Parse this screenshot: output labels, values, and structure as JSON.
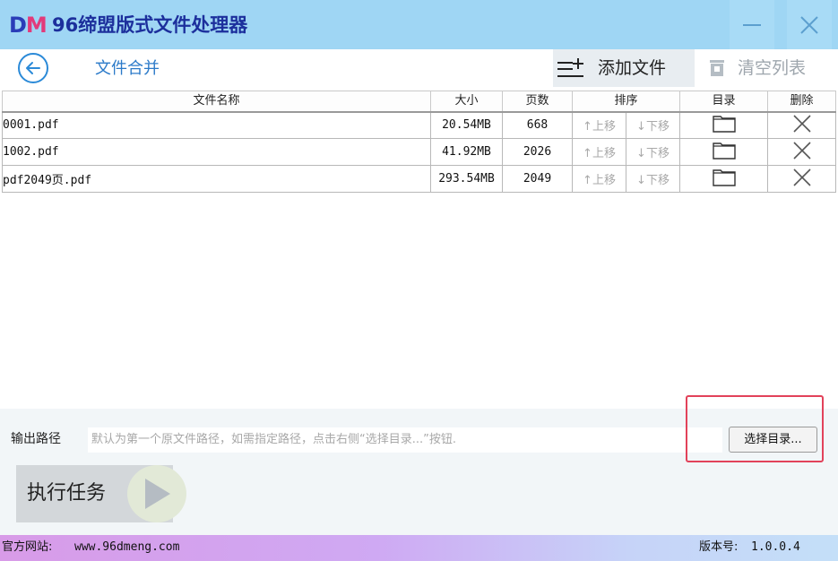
{
  "app": {
    "logo_d": "D",
    "logo_m": "M",
    "title": "96缔盟版式文件处理器"
  },
  "toolbar": {
    "page_title": "文件合并",
    "add_label": "添加文件",
    "clear_label": "清空列表"
  },
  "table": {
    "headers": [
      "文件名称",
      "大小",
      "页数",
      "排序",
      "目录",
      "删除"
    ],
    "move_up_label": "上移",
    "move_down_label": "下移",
    "rows": [
      {
        "name": "0001.pdf",
        "size": "20.54MB",
        "pages": "668"
      },
      {
        "name": "1002.pdf",
        "size": "41.92MB",
        "pages": "2026"
      },
      {
        "name": "pdf2049页.pdf",
        "size": "293.54MB",
        "pages": "2049"
      }
    ]
  },
  "output": {
    "label": "输出路径",
    "placeholder": "默认为第一个原文件路径，如需指定路径，点击右侧“选择目录...”按钮.",
    "select_label": "选择目录..."
  },
  "execute": {
    "label": "执行任务"
  },
  "status": {
    "site_label": "官方网站:",
    "site_url": "www.96dmeng.com",
    "version_label": "版本号:",
    "version_value": "1.0.0.4"
  },
  "colors": {
    "titlebar": "#9fd6f4",
    "title_text": "#1c2f9c",
    "accent": "#2b7ac9",
    "highlight_box": "#e2425a"
  },
  "icons": [
    "back-arrow-icon",
    "add-list-icon",
    "trash-icon",
    "folder-icon",
    "close-icon",
    "minimize-icon",
    "play-icon",
    "arrow-up-icon",
    "arrow-down-icon"
  ]
}
